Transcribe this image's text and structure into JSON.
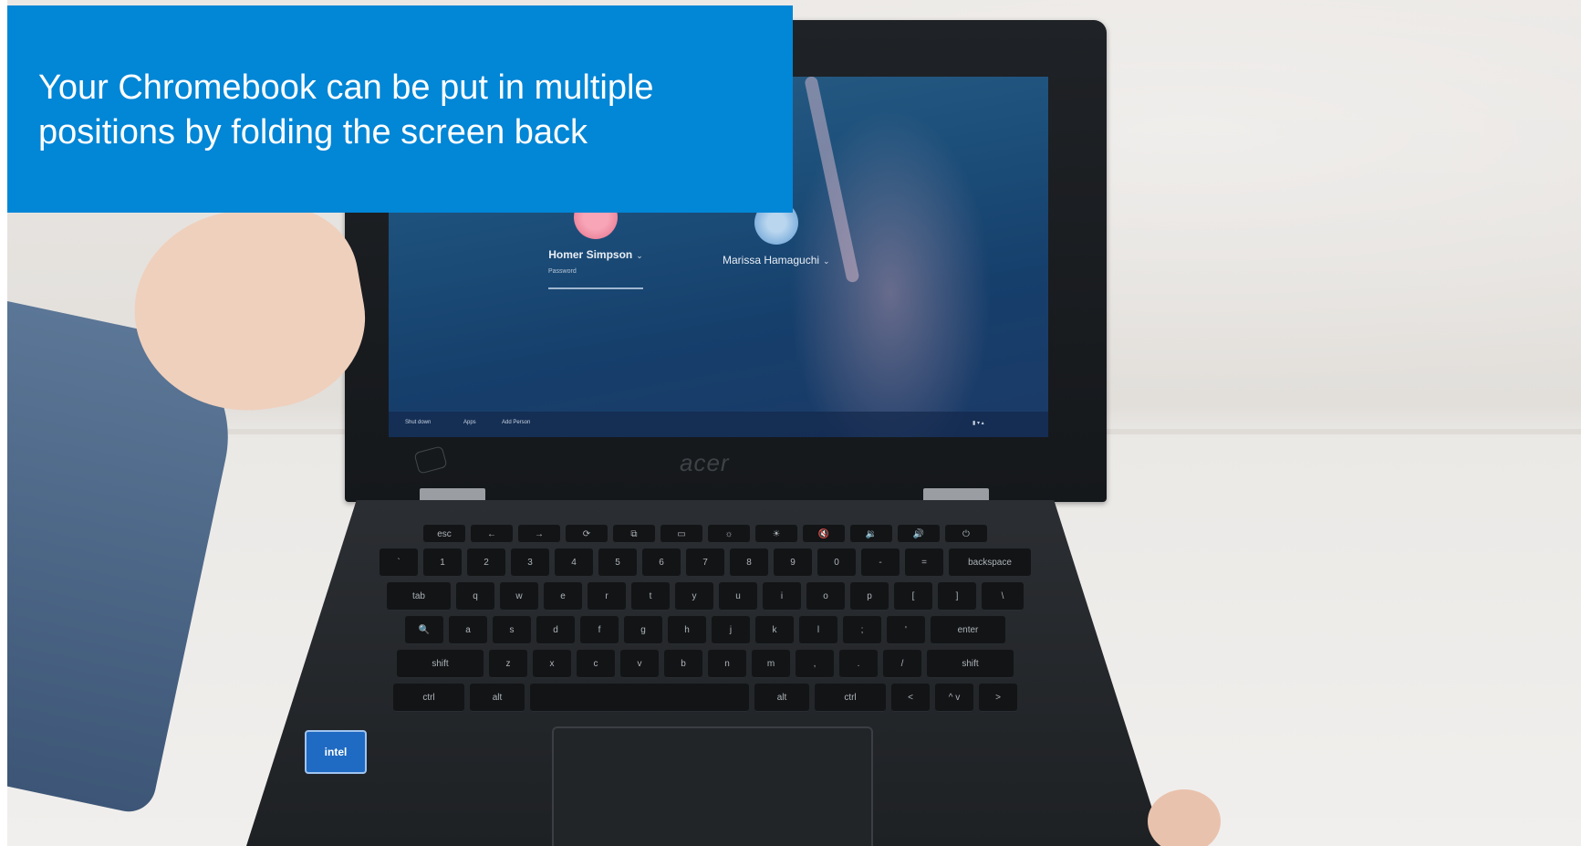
{
  "caption": {
    "text": "Your Chromebook can be put in multiple positions by folding the screen back",
    "background_color": "#0286d6"
  },
  "screen": {
    "users": [
      {
        "name": "Homer Simpson",
        "field_label": "Password"
      },
      {
        "name": "Marissa Hamaguchi"
      }
    ],
    "shelf_items": [
      "Shut down",
      "Apps",
      "Add Person"
    ]
  },
  "laptop": {
    "brand": "acer",
    "badge": "intel"
  },
  "keyboard": {
    "rows": [
      [
        "esc",
        "←",
        "→",
        "⟳",
        "⧉",
        "▭",
        "☼",
        "☀",
        "🔇",
        "🔉",
        "🔊",
        "⏻"
      ],
      [
        "`",
        "1",
        "2",
        "3",
        "4",
        "5",
        "6",
        "7",
        "8",
        "9",
        "0",
        "-",
        "=",
        "backspace"
      ],
      [
        "tab",
        "q",
        "w",
        "e",
        "r",
        "t",
        "y",
        "u",
        "i",
        "o",
        "p",
        "[",
        "]",
        "\\"
      ],
      [
        "🔍",
        "a",
        "s",
        "d",
        "f",
        "g",
        "h",
        "j",
        "k",
        "l",
        ";",
        "'",
        "enter"
      ],
      [
        "shift",
        "z",
        "x",
        "c",
        "v",
        "b",
        "n",
        "m",
        ",",
        ".",
        "/",
        "shift"
      ],
      [
        "ctrl",
        "alt",
        " ",
        "alt",
        "ctrl",
        "<",
        "^ v",
        ">"
      ]
    ]
  }
}
